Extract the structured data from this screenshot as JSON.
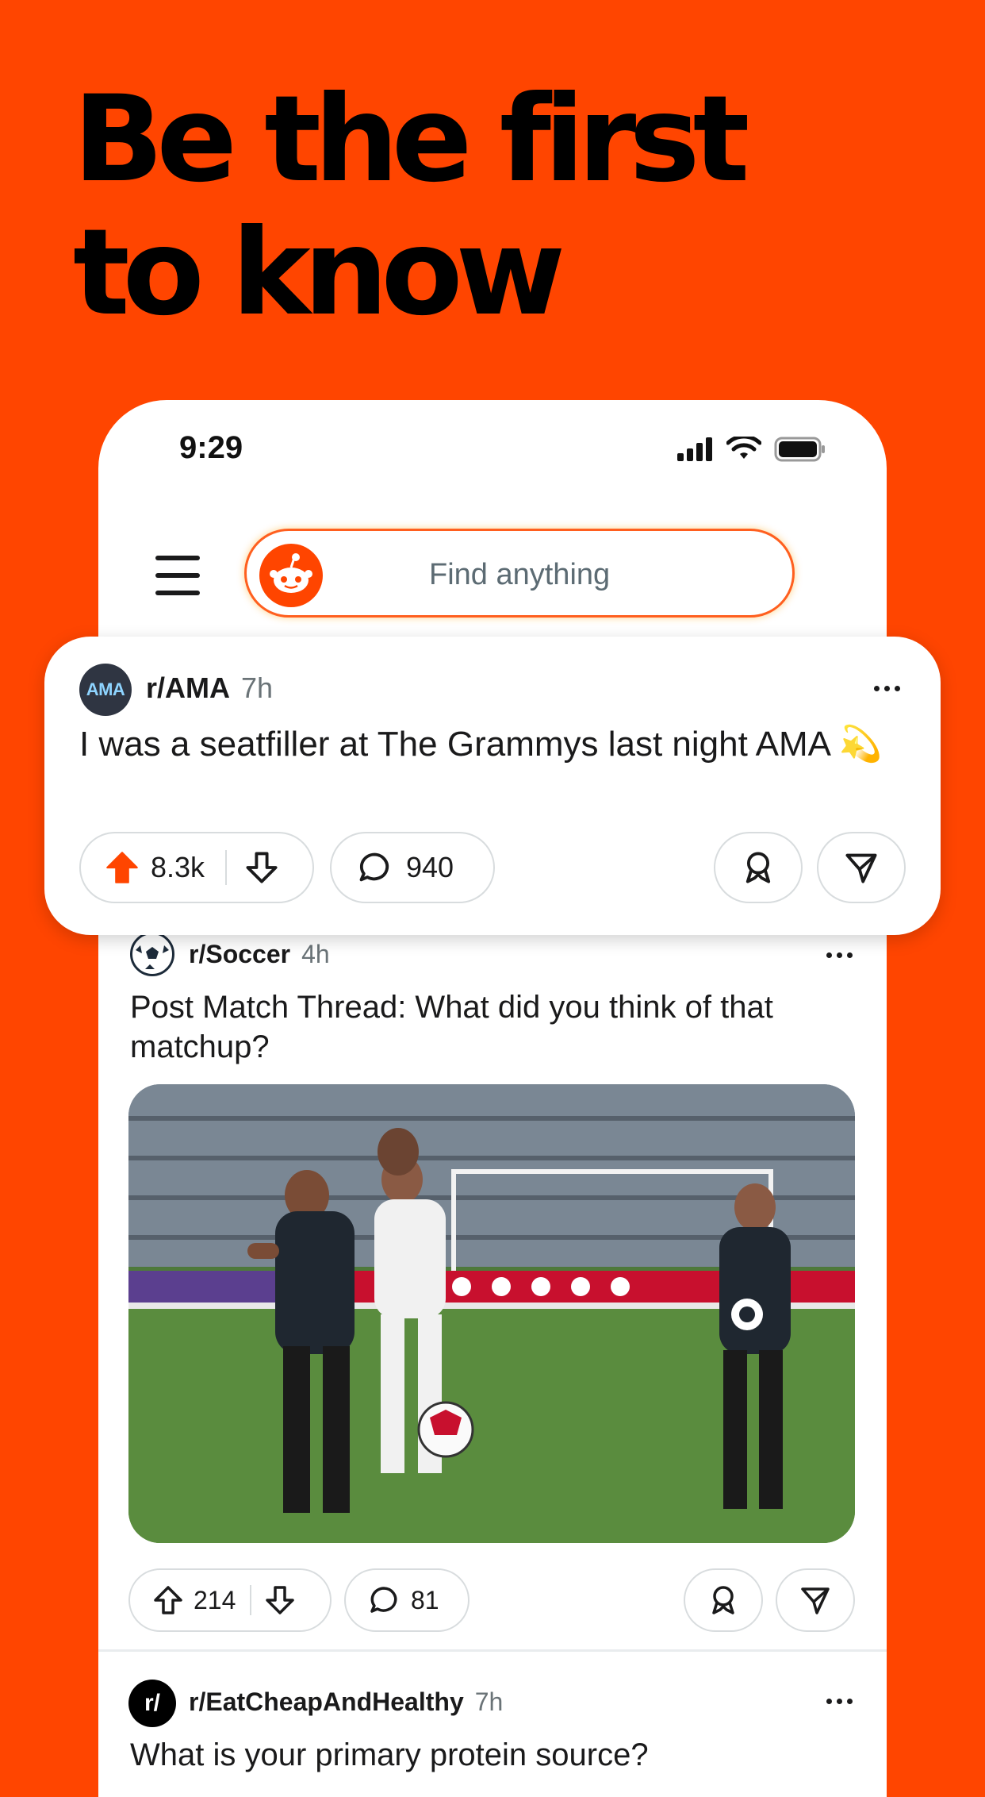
{
  "headline": {
    "line1": "Be the first",
    "line2": "to know"
  },
  "status_bar": {
    "time": "9:29"
  },
  "search": {
    "placeholder": "Find anything"
  },
  "featured_post": {
    "avatar_text": "AMA",
    "subreddit": "r/AMA",
    "age": "7h",
    "title": "I was a seatfiller at The Grammys last night AMA 💫",
    "upvotes": "8.3k",
    "comments": "940",
    "upvoted": true
  },
  "soccer_post": {
    "subreddit": "r/Soccer",
    "age": "4h",
    "title": "Post Match Thread: What did you think of that matchup?",
    "image_alt": "soccer-match-photo",
    "upvotes": "214",
    "comments": "81"
  },
  "third_post": {
    "avatar_text": "r/",
    "subreddit": "r/EatCheapAndHealthy",
    "age": "7h",
    "title": "What is your primary protein source?"
  },
  "colors": {
    "background": "#FF4500",
    "accent": "#FF4500",
    "card": "#FFFFFF",
    "border": "#D8DCDE"
  },
  "icons": [
    "menu-icon",
    "reddit-snoo-icon",
    "signal-icon",
    "wifi-icon",
    "battery-icon",
    "more-icon",
    "upvote-icon",
    "downvote-icon",
    "comment-icon",
    "award-icon",
    "share-icon"
  ]
}
